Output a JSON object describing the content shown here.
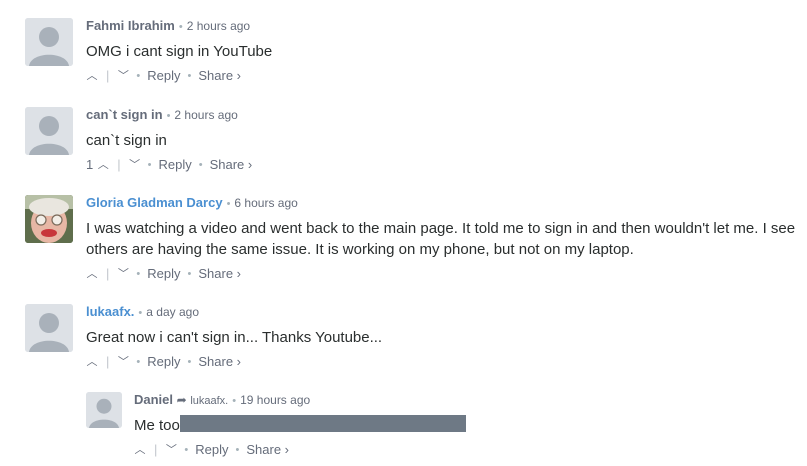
{
  "comments": [
    {
      "author": "Fahmi Ibrahim",
      "time": "2 hours ago",
      "text": "OMG i cant sign in YouTube",
      "votes": "",
      "reply": "Reply",
      "share": "Share ›"
    },
    {
      "author": "can`t sign in",
      "time": "2 hours ago",
      "text": "can`t sign in",
      "votes": "1",
      "reply": "Reply",
      "share": "Share ›"
    },
    {
      "author": "Gloria Gladman Darcy",
      "time": "6 hours ago",
      "text": "I was watching a video and went back to the main page. It told me to sign in and then wouldn't let me. I see others are having the same issue. It is working on my phone, but not on my laptop.",
      "votes": "",
      "reply": "Reply",
      "share": "Share ›"
    },
    {
      "author": "lukaafx.",
      "time": "a day ago",
      "text": "Great now i can't sign in... Thanks Youtube...",
      "votes": "",
      "reply": "Reply",
      "share": "Share ›"
    },
    {
      "author": "Daniel",
      "reply_to": "lukaafx.",
      "time": "19 hours ago",
      "text": "Me too",
      "votes": "",
      "reply": "Reply",
      "share": "Share ›"
    }
  ],
  "icons": {
    "upvote": "chevron-up-icon",
    "downvote": "chevron-down-icon",
    "reply_arrow": "reply-arrow-icon"
  },
  "colors": {
    "author_default": "#656c7a",
    "author_link": "#4a8fd1",
    "redaction": "#6e7985"
  }
}
